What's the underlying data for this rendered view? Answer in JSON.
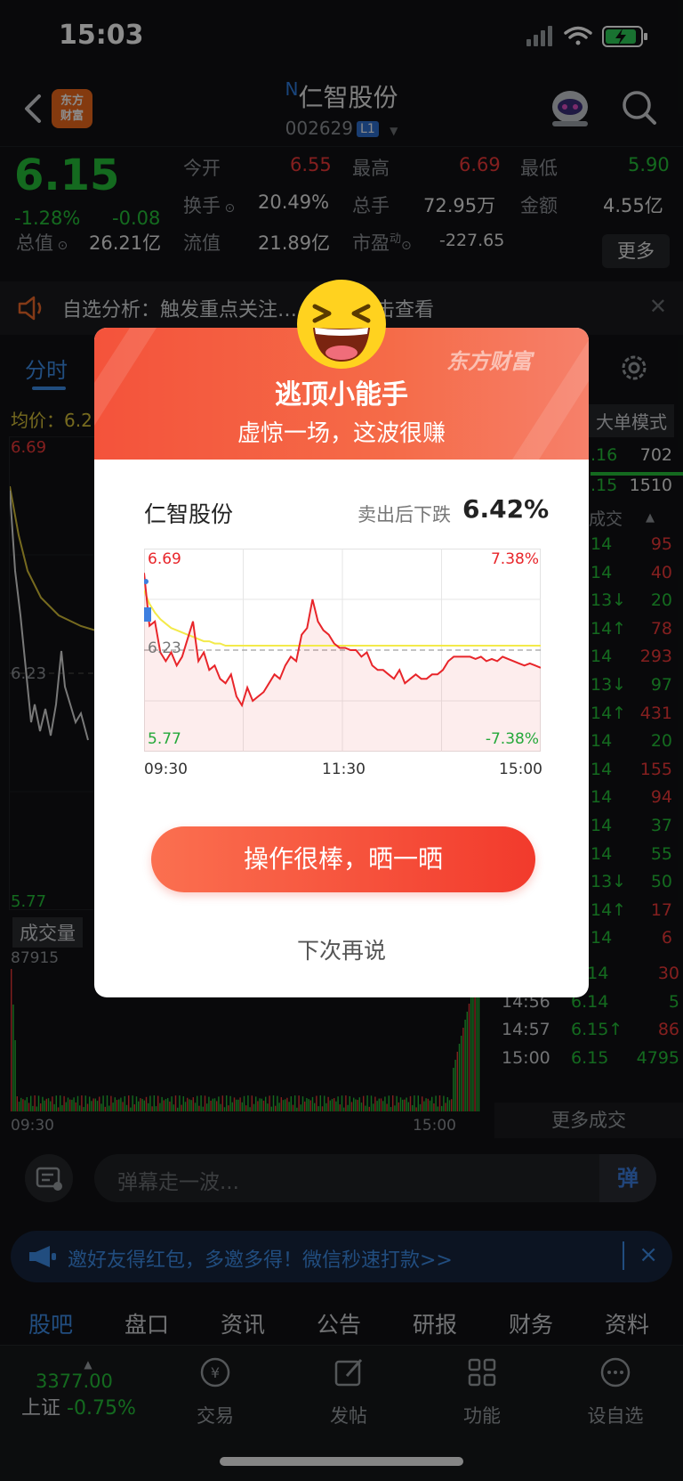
{
  "status": {
    "time": "15:03"
  },
  "header": {
    "logo_line1": "东方",
    "logo_line2": "财富",
    "stock_prefix": "N",
    "stock_name": "仁智股份",
    "stock_code": "002629",
    "level_badge": "L1"
  },
  "quote": {
    "price": "6.15",
    "change_pct": "-1.28%",
    "change_amt": "-0.08",
    "labels": {
      "open": "今开",
      "high": "最高",
      "low": "最低",
      "turnover": "换手",
      "volume": "总手",
      "amount": "金额",
      "total_cap": "总值",
      "float_cap": "流值",
      "pe": "市盈",
      "pe_sup": "动"
    },
    "open": "6.55",
    "high": "6.69",
    "low": "5.90",
    "turnover": "20.49%",
    "volume": "72.95万",
    "amount": "4.55亿",
    "total_cap": "26.21亿",
    "float_cap": "21.89亿",
    "pe": "-227.65",
    "more": "更多"
  },
  "notice": {
    "text": "自选分析：触发重点关注……立即点击查看"
  },
  "chart_tabs": {
    "active": "分时"
  },
  "left_chart": {
    "avg_label": "均价：6.2",
    "top_price": "6.69",
    "mid_price": "6.23",
    "bottom_price": "5.77",
    "vol_label": "成交量",
    "vol_value": "87915",
    "x_start": "09:30",
    "x_end": "15:00"
  },
  "right_panel": {
    "big_order": "大单模式",
    "book": [
      {
        "price": ".16",
        "vol": "702"
      },
      {
        "price": ".15",
        "vol": "1510"
      }
    ],
    "header": "成交",
    "trades": [
      {
        "p": "14",
        "v": "95",
        "vc": "red"
      },
      {
        "p": "14",
        "v": "40",
        "vc": "red"
      },
      {
        "p": "13↓",
        "v": "20",
        "vc": "green"
      },
      {
        "p": "14↑",
        "v": "78",
        "vc": "red"
      },
      {
        "p": "14",
        "v": "293",
        "vc": "red"
      },
      {
        "p": "13↓",
        "v": "97",
        "vc": "green"
      },
      {
        "p": "14↑",
        "v": "431",
        "vc": "red"
      },
      {
        "p": "14",
        "v": "20",
        "vc": "green"
      },
      {
        "p": "14",
        "v": "155",
        "vc": "red"
      },
      {
        "p": "14",
        "v": "94",
        "vc": "red"
      },
      {
        "p": "14",
        "v": "37",
        "vc": "green"
      },
      {
        "p": "14",
        "v": "55",
        "vc": "green"
      },
      {
        "p": "13↓",
        "v": "50",
        "vc": "green"
      },
      {
        "p": "14↑",
        "v": "17",
        "vc": "red"
      },
      {
        "p": "14",
        "v": "6",
        "vc": "red"
      }
    ],
    "tail_trades": [
      {
        "t": "14:56",
        "p": "6.14",
        "v": "30",
        "vc": "red"
      },
      {
        "t": "14:56",
        "p": "6.14",
        "v": "5",
        "vc": "green"
      },
      {
        "t": "14:57",
        "p": "6.15↑",
        "v": "86",
        "vc": "red"
      },
      {
        "t": "15:00",
        "p": "6.15",
        "v": "4795",
        "vc": "green"
      }
    ],
    "more_trades": "更多成交"
  },
  "danmu": {
    "placeholder": "弹幕走一波...",
    "send": "弹"
  },
  "invite": {
    "text": "邀好友得红包，多邀多得！微信秒速打款>>",
    "close": "×"
  },
  "bottom_tabs": [
    "股吧",
    "盘口",
    "资讯",
    "公告",
    "研报",
    "财务",
    "资料"
  ],
  "toolbar": {
    "index_value": "3377.00",
    "index_name": "上证",
    "index_change": "-0.75%",
    "items": [
      "交易",
      "发帖",
      "功能",
      "设自选"
    ]
  },
  "modal": {
    "brand": "东方财富",
    "title": "逃顶小能手",
    "subtitle": "虚惊一场，这波很赚",
    "stock_name": "仁智股份",
    "drop_label": "卖出后下跌",
    "drop_value": "6.42%",
    "share_button": "操作很棒，晒一晒",
    "later_button": "下次再说"
  },
  "chart_data": {
    "type": "line",
    "y_top_label": "6.69",
    "y_mid_label": "6.23",
    "y_bottom_label": "5.77",
    "pct_top": "7.38%",
    "pct_bottom": "-7.38%",
    "x_labels": [
      "09:30",
      "11:30",
      "15:00"
    ],
    "ylim": [
      5.77,
      6.69
    ],
    "reference": 6.23,
    "series": [
      {
        "values": [
          6.58,
          6.34,
          6.36,
          6.22,
          6.18,
          6.22,
          6.16,
          6.2,
          6.28,
          6.36,
          6.18,
          6.22,
          6.14,
          6.16,
          6.1,
          6.08,
          6.12,
          6.02,
          5.98,
          6.06,
          6.0,
          6.02,
          6.04,
          6.08,
          6.12,
          6.1,
          6.16,
          6.2,
          6.18,
          6.3,
          6.33,
          6.46,
          6.36,
          6.32,
          6.3,
          6.26,
          6.24,
          6.24,
          6.23,
          6.23,
          6.2,
          6.22,
          6.16,
          6.14,
          6.14,
          6.12,
          6.1,
          6.14,
          6.08,
          6.1,
          6.12,
          6.1,
          6.1,
          6.12,
          6.12,
          6.14,
          6.18,
          6.2,
          6.2,
          6.2,
          6.2,
          6.19,
          6.2,
          6.18,
          6.19,
          6.18,
          6.2,
          6.19,
          6.18,
          6.17,
          6.16,
          6.17,
          6.16,
          6.15
        ]
      },
      {
        "values": [
          6.5,
          6.44,
          6.4,
          6.37,
          6.35,
          6.33,
          6.32,
          6.31,
          6.3,
          6.29,
          6.28,
          6.27,
          6.27,
          6.26,
          6.26,
          6.25,
          6.25,
          6.25,
          6.25,
          6.25,
          6.25,
          6.25,
          6.25,
          6.25,
          6.25,
          6.25,
          6.25,
          6.25,
          6.25,
          6.25,
          6.25,
          6.25,
          6.25
        ]
      }
    ]
  }
}
